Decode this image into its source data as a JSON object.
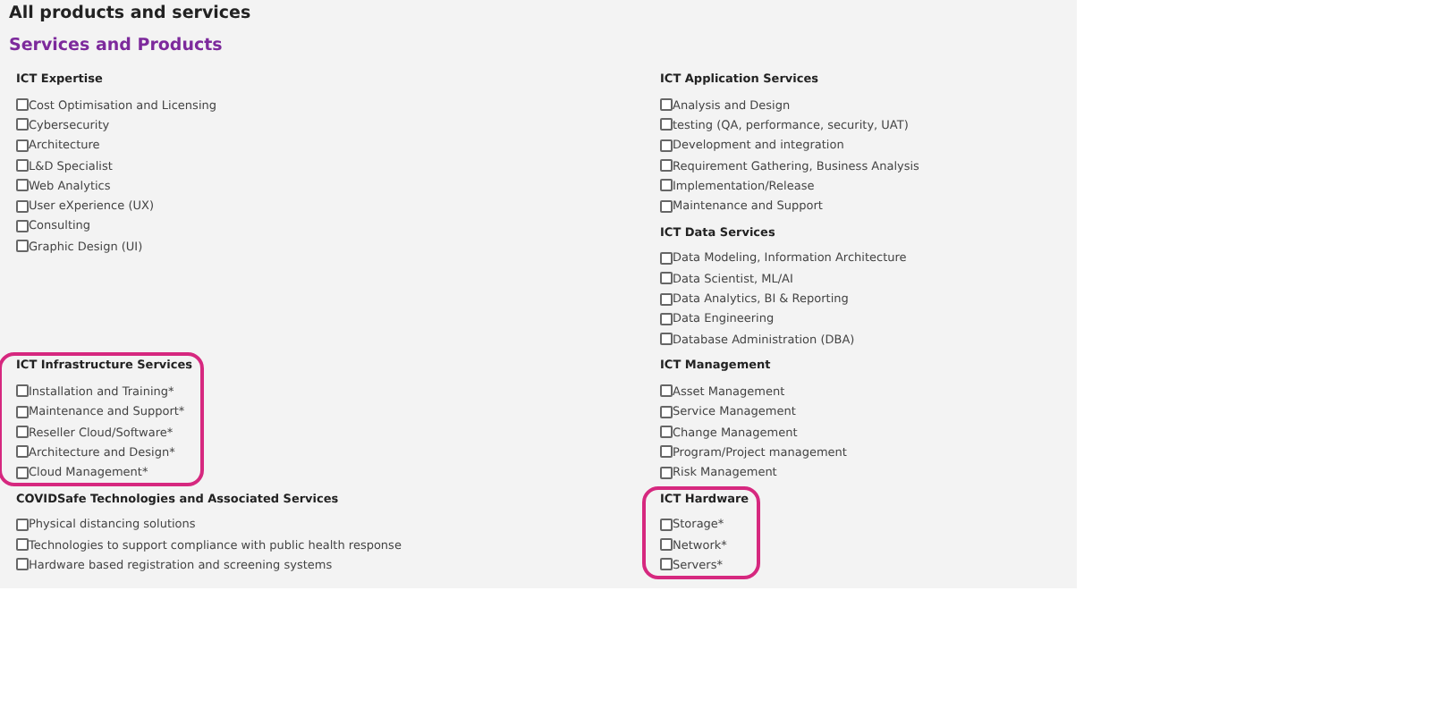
{
  "page_title": "All products and services",
  "section_title": "Services and Products",
  "rows": [
    {
      "left": [
        {
          "heading": "ICT Expertise",
          "highlighted": false,
          "items": [
            {
              "label": "Cost Optimisation and Licensing",
              "checked": false
            },
            {
              "label": "Cybersecurity",
              "checked": false
            },
            {
              "label": "Architecture",
              "checked": false
            },
            {
              "label": "L&D Specialist",
              "checked": false
            },
            {
              "label": "Web Analytics",
              "checked": false
            },
            {
              "label": "User eXperience (UX)",
              "checked": false
            },
            {
              "label": "Consulting",
              "checked": false
            },
            {
              "label": "Graphic Design (UI)",
              "checked": false
            }
          ]
        }
      ],
      "right": [
        {
          "heading": "ICT Application Services",
          "highlighted": false,
          "items": [
            {
              "label": "Analysis and Design",
              "checked": false
            },
            {
              "label": "testing (QA, performance, security, UAT)",
              "checked": false
            },
            {
              "label": "Development and integration",
              "checked": false
            },
            {
              "label": "Requirement Gathering, Business Analysis",
              "checked": false
            },
            {
              "label": "Implementation/Release",
              "checked": false
            },
            {
              "label": "Maintenance and Support",
              "checked": false
            }
          ]
        },
        {
          "heading": "ICT Data Services",
          "highlighted": false,
          "items": [
            {
              "label": "Data Modeling, Information Architecture",
              "checked": false
            },
            {
              "label": "Data Scientist, ML/AI",
              "checked": false
            },
            {
              "label": "Data Analytics, BI & Reporting",
              "checked": false
            },
            {
              "label": "Data Engineering",
              "checked": false
            },
            {
              "label": "Database Administration (DBA)",
              "checked": false
            }
          ]
        }
      ]
    },
    {
      "left": [
        {
          "heading": "ICT Infrastructure Services",
          "highlighted": true,
          "items": [
            {
              "label": "Installation and Training*",
              "checked": false
            },
            {
              "label": "Maintenance and Support*",
              "checked": false
            },
            {
              "label": "Reseller Cloud/Software*",
              "checked": false
            },
            {
              "label": "Architecture and Design*",
              "checked": false
            },
            {
              "label": "Cloud Management*",
              "checked": false
            }
          ]
        }
      ],
      "right": [
        {
          "heading": "ICT Management",
          "highlighted": false,
          "items": [
            {
              "label": "Asset Management",
              "checked": false
            },
            {
              "label": "Service Management",
              "checked": false
            },
            {
              "label": "Change Management",
              "checked": false
            },
            {
              "label": "Program/Project management",
              "checked": false
            },
            {
              "label": "Risk Management",
              "checked": false
            }
          ]
        }
      ]
    },
    {
      "left": [
        {
          "heading": "COVIDSafe Technologies and Associated Services",
          "highlighted": false,
          "items": [
            {
              "label": "Physical distancing solutions",
              "checked": false
            },
            {
              "label": "Technologies to support compliance with public health response",
              "checked": false
            },
            {
              "label": "Hardware based registration and screening systems",
              "checked": false
            }
          ]
        }
      ],
      "right": [
        {
          "heading": "ICT Hardware",
          "highlighted": true,
          "items": [
            {
              "label": "Storage*",
              "checked": false
            },
            {
              "label": "Network*",
              "checked": false
            },
            {
              "label": "Servers*",
              "checked": false
            }
          ]
        }
      ]
    }
  ]
}
